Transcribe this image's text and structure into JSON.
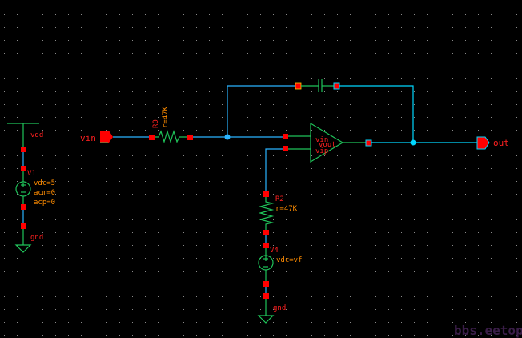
{
  "colors": {
    "background": "#000000",
    "wire": "#2ab4ff",
    "symbol": "#1fc45a",
    "pin": "#ff0000",
    "label": "#ff2020",
    "parameter": "#ff8c00"
  },
  "vdd_source": {
    "net_top": "vdd",
    "name": "V1",
    "params": [
      "vdc=5",
      "acm=0",
      "acp=0"
    ],
    "net_bottom": "gnd"
  },
  "input_pin": {
    "name": "vin"
  },
  "output_pin": {
    "name": "out"
  },
  "r0": {
    "name": "R0",
    "value": "r=47K"
  },
  "r2": {
    "name": "R2",
    "value": "r=47K"
  },
  "v4": {
    "name": "V4",
    "params": [
      "vdc=vf"
    ],
    "net_bottom": "gnd"
  },
  "opamp": {
    "pins": [
      "vin",
      "vout",
      "vip"
    ]
  },
  "watermark": "bbs.eetop.cn"
}
